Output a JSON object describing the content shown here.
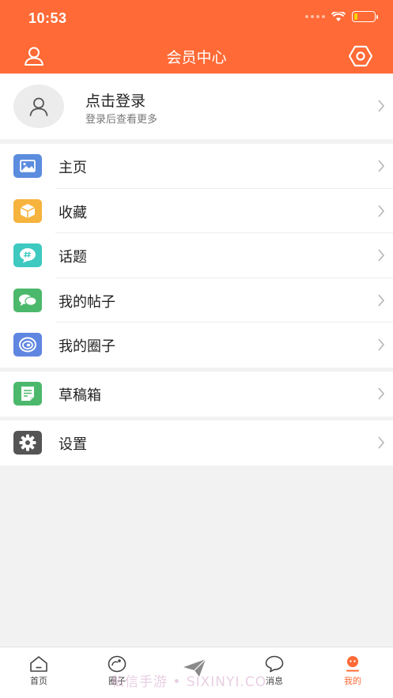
{
  "status_bar": {
    "time": "10:53",
    "battery_percent": 15
  },
  "nav": {
    "title": "会员中心",
    "left_icon": "user-icon",
    "right_icon": "settings-icon"
  },
  "login": {
    "title": "点击登录",
    "subtitle": "登录后查看更多"
  },
  "menu_groups": [
    {
      "items": [
        {
          "label": "主页",
          "icon": "image-icon",
          "color": "#5b8cde"
        },
        {
          "label": "收藏",
          "icon": "box-icon",
          "color": "#f6b33d"
        },
        {
          "label": "话题",
          "icon": "hashtag-bubble-icon",
          "color": "#3ec9c1"
        },
        {
          "label": "我的帖子",
          "icon": "chat-bubbles-icon",
          "color": "#4cb86b"
        },
        {
          "label": "我的圈子",
          "icon": "circle-swirl-icon",
          "color": "#5f86e0"
        }
      ]
    },
    {
      "items": [
        {
          "label": "草稿箱",
          "icon": "draft-icon",
          "color": "#4cb86b"
        }
      ]
    },
    {
      "items": [
        {
          "label": "设置",
          "icon": "gear-icon",
          "color": "#555555"
        }
      ]
    }
  ],
  "tabbar": {
    "tabs": [
      {
        "label": "首页",
        "icon": "home-icon"
      },
      {
        "label": "圈子",
        "icon": "circle-icon"
      },
      {
        "label": "",
        "icon": "send-icon"
      },
      {
        "label": "消息",
        "icon": "message-icon"
      },
      {
        "label": "我的",
        "icon": "mine-icon",
        "active": true
      }
    ]
  },
  "watermark": "私信手游 • SIXINYI.CO",
  "colors": {
    "accent": "#ff6a36",
    "background": "#f2f2f2"
  }
}
